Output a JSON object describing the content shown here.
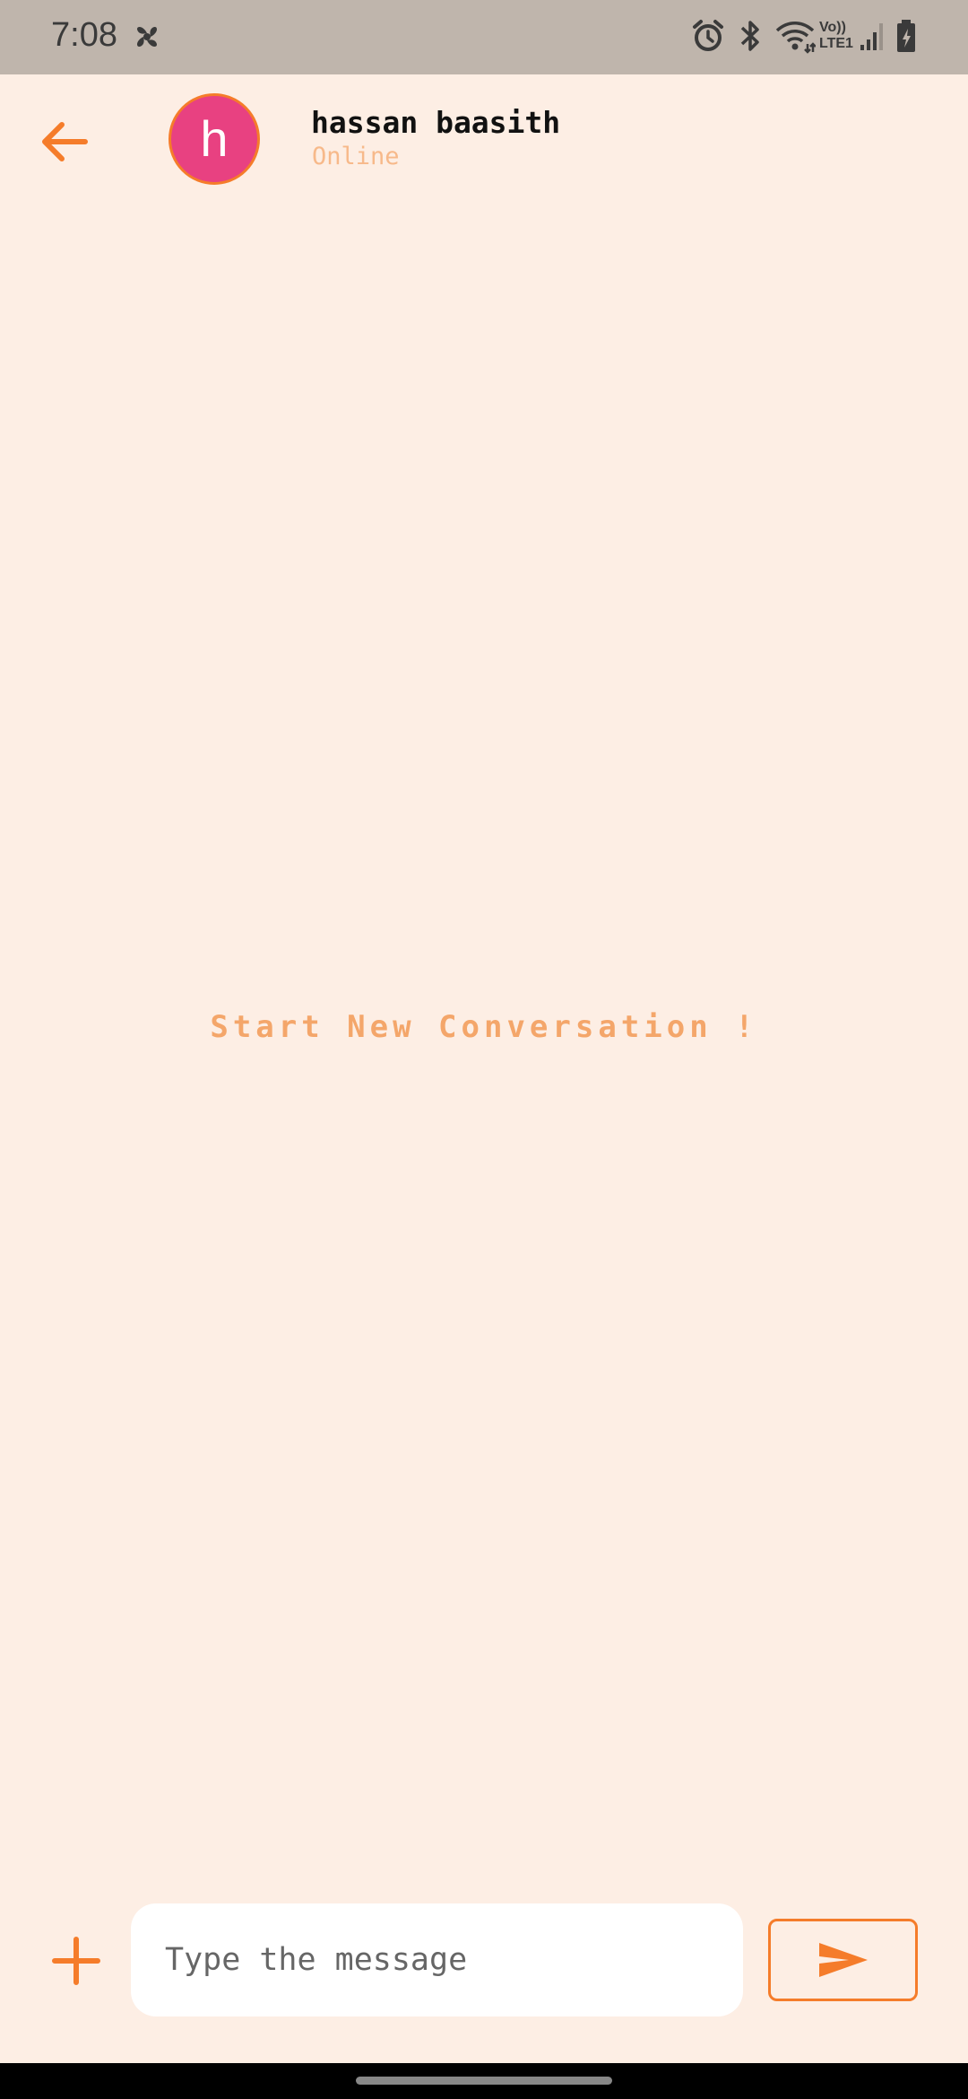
{
  "status_bar": {
    "time": "7:08",
    "network_label_top": "Vo))",
    "network_label_bottom": "LTE1"
  },
  "header": {
    "avatar_letter": "h",
    "contact_name": "hassan baasith",
    "contact_status": "Online"
  },
  "conversation": {
    "empty_message": "Start New Conversation !"
  },
  "composer": {
    "placeholder": "Type the message",
    "value": ""
  },
  "colors": {
    "accent": "#f57c2a",
    "avatar_bg": "#e84181",
    "background": "#fdeee4",
    "status_bar_bg": "#bfb5ac"
  },
  "icons": {
    "back": "arrow-left-icon",
    "attach": "plus-icon",
    "send": "send-icon",
    "status": [
      "pinwheel-icon",
      "alarm-icon",
      "bluetooth-icon",
      "wifi-icon",
      "signal-icon",
      "battery-icon"
    ]
  }
}
